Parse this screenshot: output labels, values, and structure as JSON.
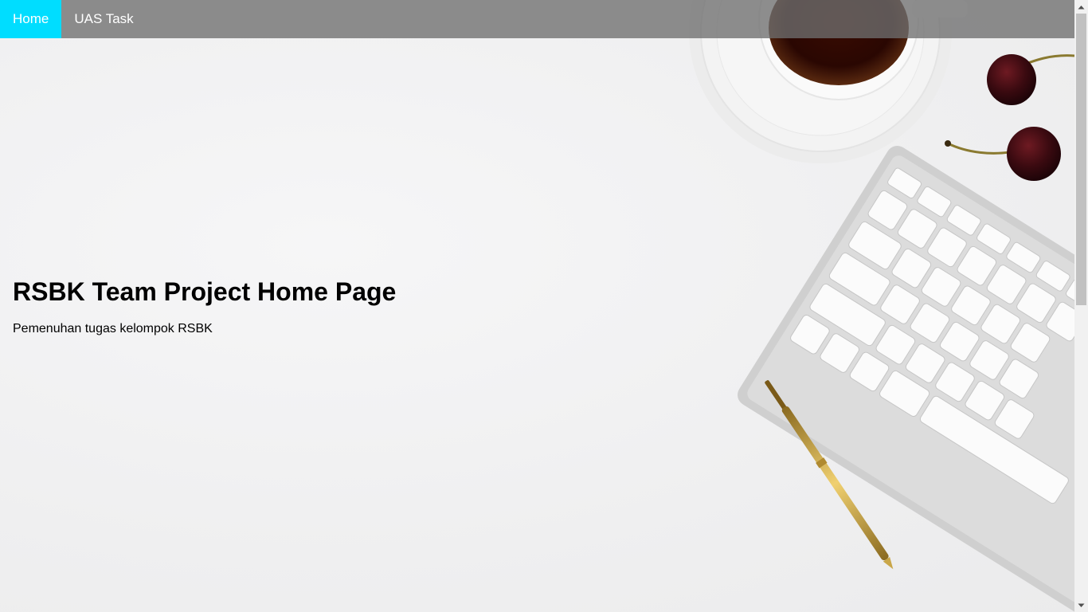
{
  "nav": {
    "items": [
      {
        "label": "Home",
        "active": true
      },
      {
        "label": "UAS Task",
        "active": false
      }
    ],
    "active_color": "#00ddff"
  },
  "hero": {
    "title": "RSBK Team Project Home Page",
    "subtitle": "Pemenuhan tugas kelompok RSBK",
    "background_image": "desk-flatlay-coffee-cherries-keyboard-pen"
  }
}
